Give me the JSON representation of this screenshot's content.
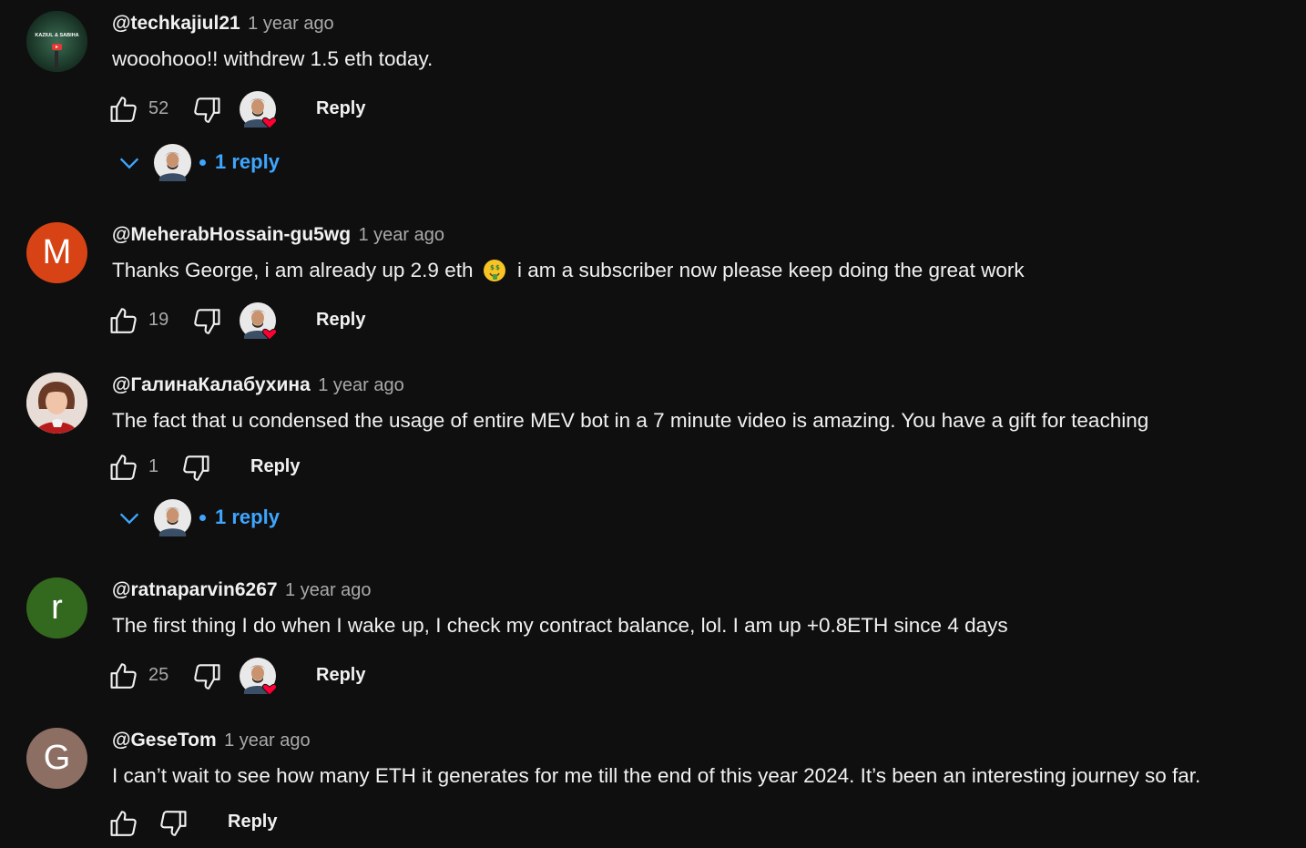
{
  "comments": [
    {
      "author": "@techkajiul21",
      "time": "1 year ago",
      "text": "wooohooo!! withdrew 1.5 eth today.",
      "likes": "52",
      "reply_label": "Reply",
      "replies_label": "1 reply",
      "avatar_caption": "KAZIUL & SABIHA"
    },
    {
      "author": "@MeherabHossain-gu5wg",
      "time": "1 year ago",
      "text_before": "Thanks George, i am already up 2.9 eth",
      "text_after": "i am a subscriber now please keep doing the great work",
      "emoji": "money-mouth-face-icon",
      "likes": "19",
      "reply_label": "Reply",
      "avatar_letter": "M",
      "avatar_color": "#d84315"
    },
    {
      "author": "@ГалинаКалабухина",
      "time": "1 year ago",
      "text": "The fact that u condensed the usage of entire MEV bot in a 7 minute video is amazing. You have a gift for teaching",
      "likes": "1",
      "reply_label": "Reply",
      "replies_label": "1 reply"
    },
    {
      "author": "@ratnaparvin6267",
      "time": "1 year ago",
      "text": "The first thing I do when I wake up, I check my contract balance, lol. I am up +0.8ETH since 4 days",
      "likes": "25",
      "reply_label": "Reply",
      "avatar_letter": "r",
      "avatar_color": "#33691e"
    },
    {
      "author": "@GeseTom",
      "time": "1 year ago",
      "text": "I can’t wait to see how many ETH it generates for me till the end of this year 2024. It’s been an interesting journey so far.",
      "reply_label": "Reply",
      "avatar_letter": "G",
      "avatar_color": "#8d6e63"
    }
  ],
  "colors": {
    "background": "#0f0f0f",
    "primary_text": "#f1f1f1",
    "secondary_text": "#aaaaaa",
    "link_blue": "#3ea6ff",
    "heart_red": "#ff0033"
  }
}
